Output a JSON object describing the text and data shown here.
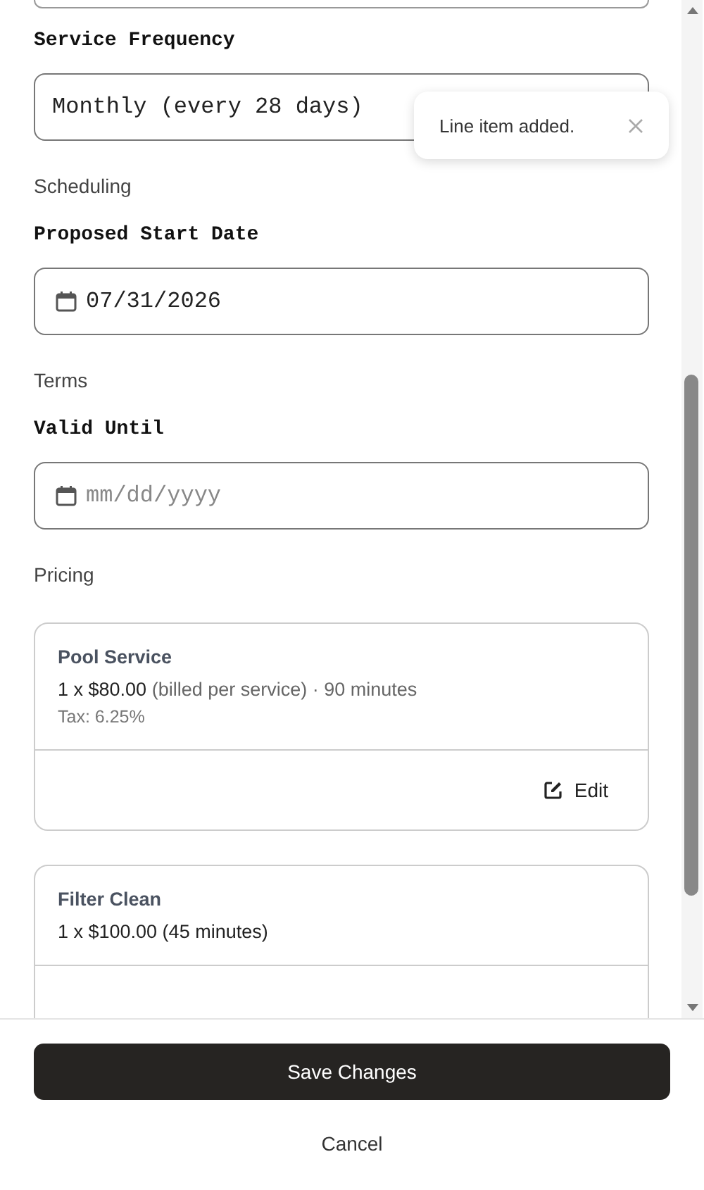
{
  "toast": {
    "message": "Line item added."
  },
  "fields": [
    {
      "kind": "select",
      "label": "Service Frequency",
      "value": "Monthly (every 28 days)"
    },
    {
      "kind": "section",
      "title": "Scheduling"
    },
    {
      "kind": "date",
      "label": "Proposed Start Date",
      "value": "07/31/2026"
    },
    {
      "kind": "section",
      "title": "Terms"
    },
    {
      "kind": "date",
      "label": "Valid Until",
      "placeholder": "mm/dd/yyyy"
    },
    {
      "kind": "section",
      "title": "Pricing"
    }
  ],
  "line_items": [
    {
      "name": "Pool Service",
      "price": "1 x $80.00",
      "note": "(billed per service) · 90 minutes",
      "tax": "Tax: 6.25%",
      "action": "Edit"
    },
    {
      "name": "Filter Clean",
      "price": "1 x $100.00 (45 minutes)"
    }
  ],
  "buttons": {
    "save": "Save Changes",
    "cancel": "Cancel"
  }
}
